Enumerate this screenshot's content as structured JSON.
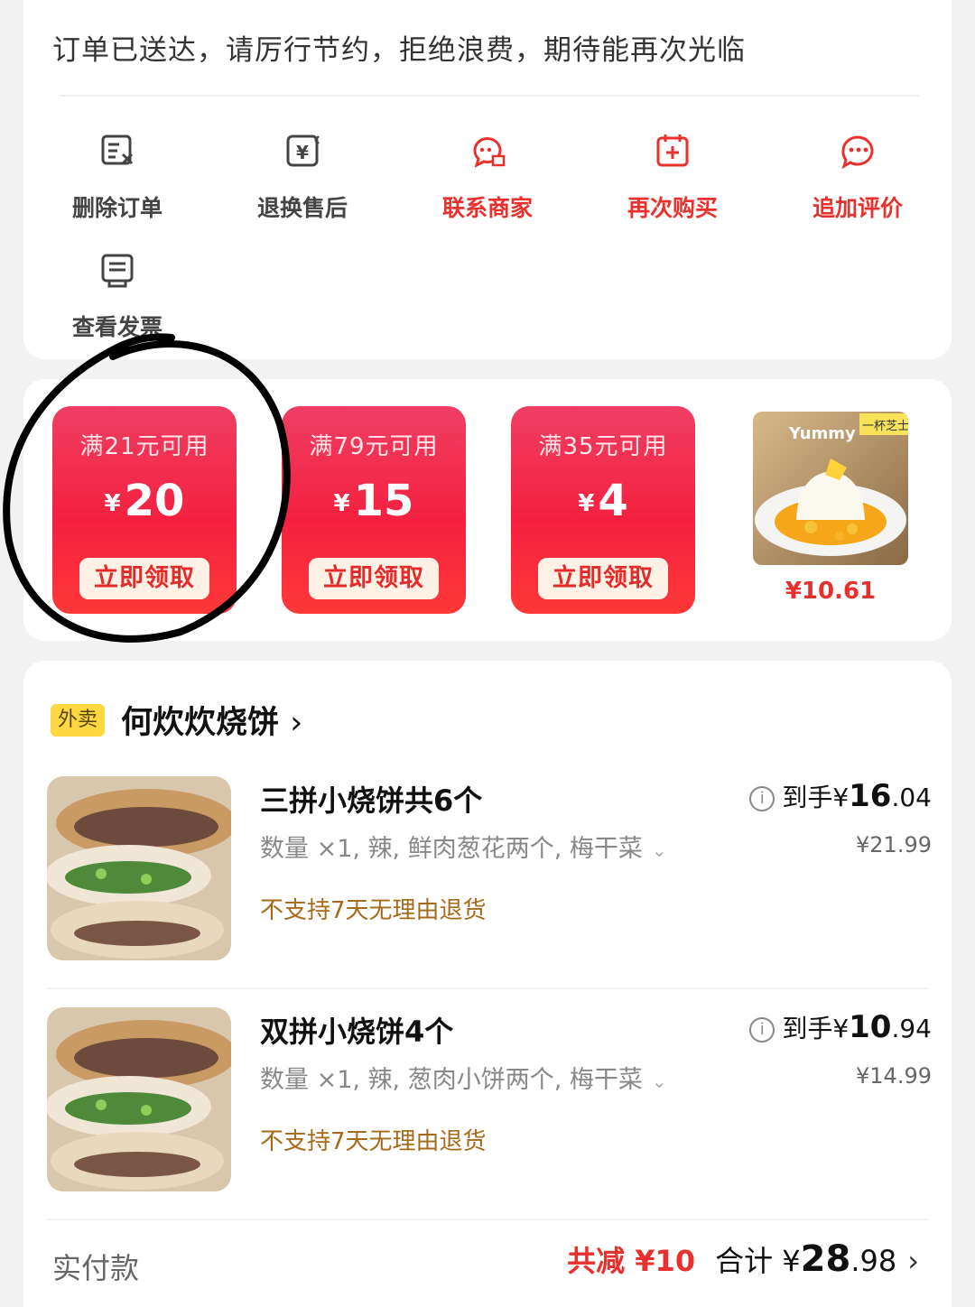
{
  "status": {
    "message": "订单已送达，请厉行节约，拒绝浪费，期待能再次光临"
  },
  "actions": [
    {
      "label": "删除订单",
      "icon": "delete-order-icon"
    },
    {
      "label": "退换售后",
      "icon": "return-exchange-icon"
    },
    {
      "label": "联系商家",
      "icon": "contact-merchant-icon"
    },
    {
      "label": "再次购买",
      "icon": "buy-again-icon"
    },
    {
      "label": "追加评价",
      "icon": "add-review-icon"
    },
    {
      "label": "查看发票",
      "icon": "view-invoice-icon"
    }
  ],
  "coupons": [
    {
      "condition": "满21元可用",
      "currency": "¥",
      "amount": "20",
      "button": "立即领取"
    },
    {
      "condition": "满79元可用",
      "currency": "¥",
      "amount": "15",
      "button": "立即领取"
    },
    {
      "condition": "满35元可用",
      "currency": "¥",
      "amount": "4",
      "button": "立即领取"
    }
  ],
  "promo": {
    "price": "¥10.61",
    "image_text": "Yummy",
    "badge_text": "一杯芝士"
  },
  "order": {
    "tag": "外卖",
    "shop_name": "何炊炊烧饼",
    "shop_chevron": "›",
    "items": [
      {
        "name": "三拼小烧饼共6个",
        "spec": "数量 ×1, 辣, 鲜肉葱花两个, 梅干菜",
        "spec_chevron": "⌄",
        "policy": "不支持7天无理由退货",
        "final_prefix": "到手¥",
        "final_int": "16",
        "final_dec": ".04",
        "original": "¥21.99",
        "info_icon": "i"
      },
      {
        "name": "双拼小烧饼4个",
        "spec": "数量 ×1, 辣, 葱肉小饼两个, 梅干菜",
        "spec_chevron": "⌄",
        "policy": "不支持7天无理由退货",
        "final_prefix": "到手¥",
        "final_int": "10",
        "final_dec": ".94",
        "original": "¥14.99",
        "info_icon": "i"
      }
    ],
    "payment": {
      "label": "实付款",
      "discount": "共减 ¥10",
      "total_prefix": "合计 ¥",
      "total_int": "28",
      "total_dec": ".98",
      "chevron": "›"
    }
  },
  "colors": {
    "accent_red": "#e8312d",
    "coupon_red": "#f5203f",
    "tag_yellow": "#ffd740",
    "policy_brown": "#a66a1a"
  }
}
